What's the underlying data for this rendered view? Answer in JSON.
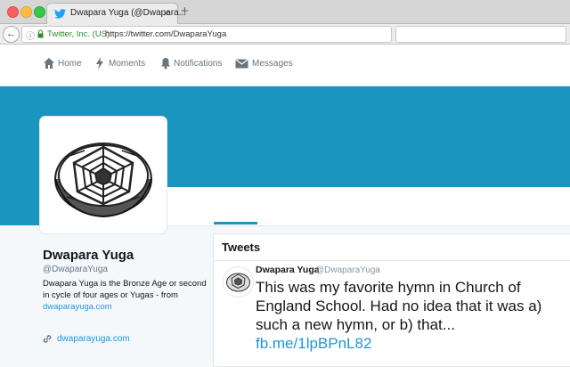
{
  "browser": {
    "tab_title": "Dwapara Yuga (@Dwapara...",
    "tab_close": "×",
    "new_tab": "+",
    "back_arrow": "←",
    "info_icon": "ⓘ",
    "company": "Twitter, Inc. (US)",
    "url": "https://twitter.com/DwaparaYuga",
    "reload": "C"
  },
  "nav": {
    "items": [
      {
        "label": "Home",
        "icon": "home-icon"
      },
      {
        "label": "Moments",
        "icon": "lightning-icon"
      },
      {
        "label": "Notifications",
        "icon": "bell-icon"
      },
      {
        "label": "Messages",
        "icon": "envelope-icon"
      }
    ]
  },
  "profile": {
    "name": "Dwapara Yuga",
    "handle": "@DwaparaYuga",
    "bio_text": "Dwapara Yuga is the Bronze Age or second in cycle of four ages or Yugas - from ",
    "bio_link": "dwaparayuga.com",
    "website": "dwaparayuga.com"
  },
  "tweets_panel": {
    "title": "Tweets",
    "tweet": {
      "author_name": "Dwapara Yuga",
      "author_handle": "@DwaparaYuga",
      "separator": "·",
      "text": "This was my favorite hymn in Church of England School.  Had no idea that it was a) such a new hymn, or b) that... ",
      "link": "fb.me/1lpBPnL82"
    }
  },
  "colors": {
    "banner": "#1b95bf",
    "link": "#1b95e0",
    "secure_green": "#2e8b2e"
  }
}
